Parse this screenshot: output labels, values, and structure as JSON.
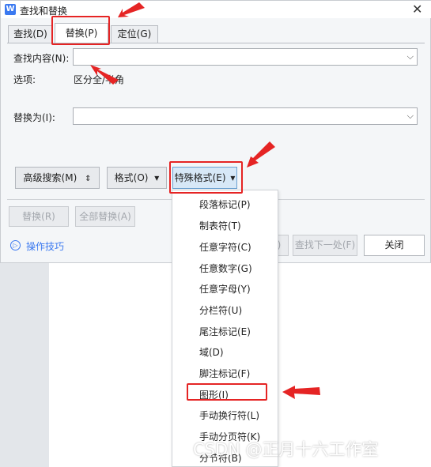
{
  "window": {
    "title": "查找和替换",
    "app_icon_label": "W",
    "close_glyph": "✕"
  },
  "tabs": [
    {
      "label": "查找(D)",
      "active": false
    },
    {
      "label": "替换(P)",
      "active": true
    },
    {
      "label": "定位(G)",
      "active": false
    }
  ],
  "find": {
    "label": "查找内容(N):",
    "value": "",
    "dropdown_glyph": "⌵"
  },
  "options": {
    "label": "选项:",
    "value": "区分全/半角"
  },
  "replace": {
    "label": "替换为(I):",
    "value": "",
    "dropdown_glyph": "⌵"
  },
  "buttons": {
    "advanced_search": "高级搜索(M)",
    "advanced_search_glyph": "⇕",
    "format": "格式(O)",
    "format_glyph": "▾",
    "special_format": "特殊格式(E)",
    "special_format_glyph": "▾",
    "replace": "替换(R)",
    "replace_all": "全部替换(A)",
    "find_prev_partial": ")",
    "find_next": "查找下一处(F)",
    "close": "关闭"
  },
  "tips": {
    "label": "操作技巧",
    "icon_glyph": "▷"
  },
  "special_format_menu": [
    "段落标记(P)",
    "制表符(T)",
    "任意字符(C)",
    "任意数字(G)",
    "任意字母(Y)",
    "分栏符(U)",
    "尾注标记(E)",
    "域(D)",
    "脚注标记(F)",
    "图形(I)",
    "手动换行符(L)",
    "手动分页符(K)",
    "分节符(B)"
  ],
  "annotation_color": "#e52424",
  "accent_color": "#3b79f0",
  "watermark": "CSDN @正月十六工作室"
}
